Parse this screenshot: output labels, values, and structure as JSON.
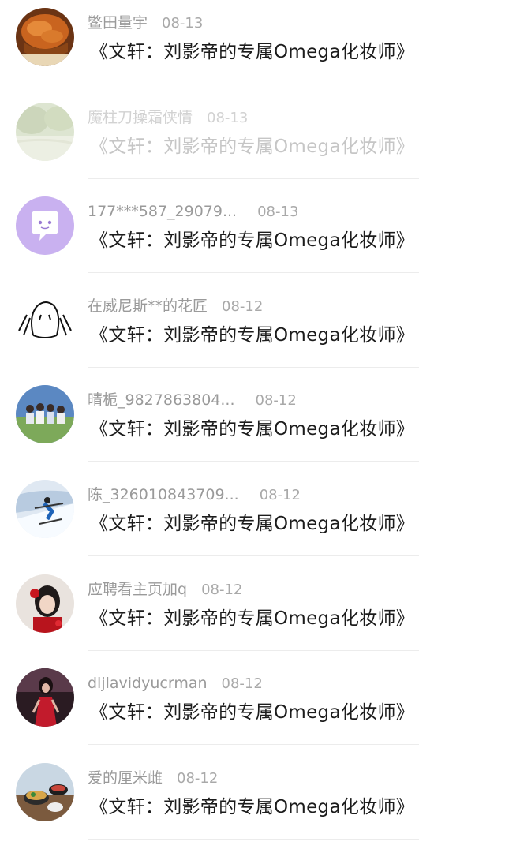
{
  "comments": [
    {
      "username": "鳖田量宇",
      "date": "08-13",
      "title": "《文轩：刘影帝的专属Omega化妆师》",
      "avatar_icon": "pastry-photo-avatar-icon"
    },
    {
      "username": "魔柱刀操霜侠情",
      "date": "08-13",
      "title": "《文轩：刘影帝的专属Omega化妆师》",
      "avatar_icon": "landscape-photo-avatar-icon"
    },
    {
      "username": "177***587_29079...",
      "date": "08-13",
      "title": "《文轩：刘影帝的专属Omega化妆师》",
      "avatar_icon": "chat-bubble-avatar-icon"
    },
    {
      "username": "在威尼斯**的花匠",
      "date": "08-12",
      "title": "《文轩：刘影帝的专属Omega化妆师》",
      "avatar_icon": "doodle-face-avatar-icon"
    },
    {
      "username": "晴栀_9827863804...",
      "date": "08-12",
      "title": "《文轩：刘影帝的专属Omega化妆师》",
      "avatar_icon": "group-photo-avatar-icon"
    },
    {
      "username": "陈_326010843709...",
      "date": "08-12",
      "title": "《文轩：刘影帝的专属Omega化妆师》",
      "avatar_icon": "skier-photo-avatar-icon"
    },
    {
      "username": "应聘看主页加q",
      "date": "08-12",
      "title": "《文轩：刘影帝的专属Omega化妆师》",
      "avatar_icon": "portrait-photo-avatar-icon"
    },
    {
      "username": "dljlavidyucrman",
      "date": "08-12",
      "title": "《文轩：刘影帝的专属Omega化妆师》",
      "avatar_icon": "red-dress-photo-avatar-icon"
    },
    {
      "username": "爱的厘米雌",
      "date": "08-12",
      "title": "《文轩：刘影帝的专属Omega化妆师》",
      "avatar_icon": "food-photo-avatar-icon"
    }
  ]
}
